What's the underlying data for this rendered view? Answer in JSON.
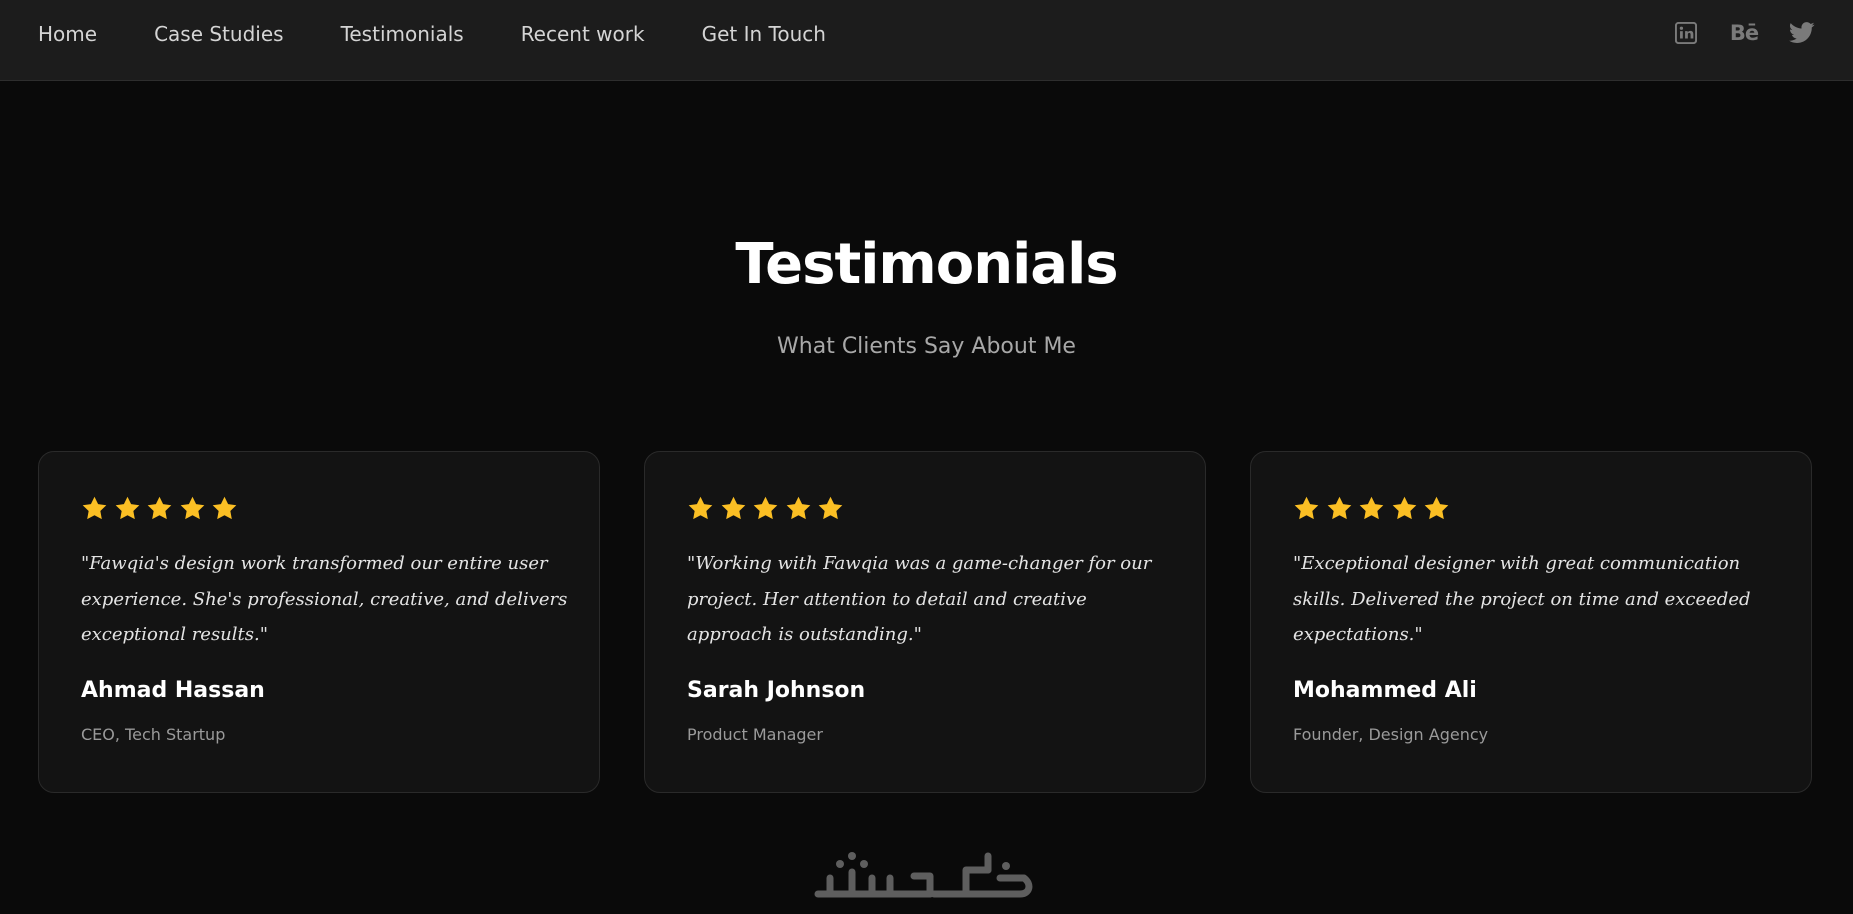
{
  "nav": {
    "links": [
      {
        "label": "Home"
      },
      {
        "label": "Case Studies"
      },
      {
        "label": "Testimonials"
      },
      {
        "label": "Recent work"
      },
      {
        "label": "Get In Touch"
      }
    ],
    "social": {
      "linkedin_icon": "linkedin-icon",
      "behance_label": "Bē",
      "twitter_icon": "twitter-icon"
    }
  },
  "section": {
    "title": "Testimonials",
    "subtitle": "What Clients Say About Me"
  },
  "testimonials": [
    {
      "rating": 5,
      "quote": "\"Fawqia's design work transformed our entire user experience. She's professional, creative, and delivers exceptional results.\"",
      "name": "Ahmad Hassan",
      "role": "CEO, Tech Startup"
    },
    {
      "rating": 5,
      "quote": "\"Working with Fawqia was a game-changer for our project. Her attention to detail and creative approach is outstanding.\"",
      "name": "Sarah Johnson",
      "role": "Product Manager"
    },
    {
      "rating": 5,
      "quote": "\"Exceptional designer with great communication skills. Delivered the project on time and exceeded expectations.\"",
      "name": "Mohammed Ali",
      "role": "Founder, Design Agency"
    }
  ],
  "footer": {
    "logo_text": "خمسات"
  },
  "colors": {
    "background": "#0a0a0a",
    "nav_background": "#1c1c1c",
    "card_background": "#131313",
    "star": "#fbbf24",
    "icon_gray": "#7a7a7a"
  }
}
